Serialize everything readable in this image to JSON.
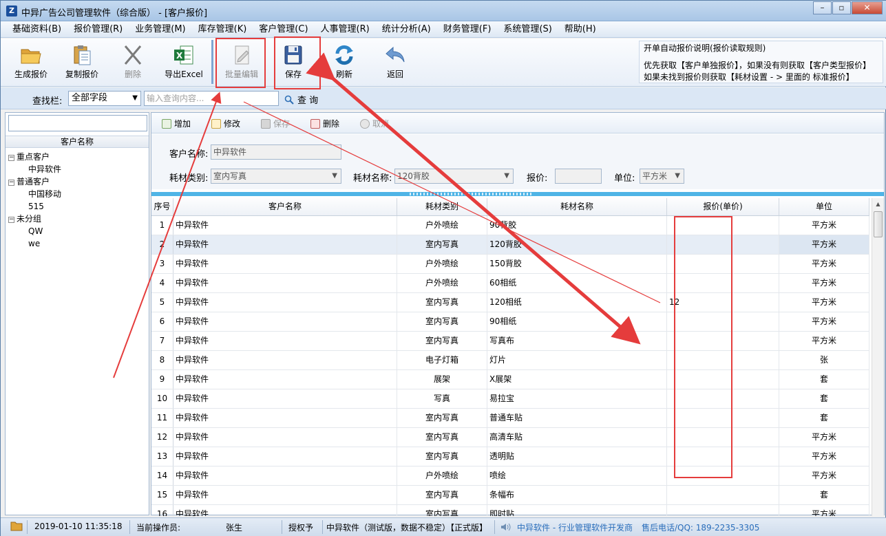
{
  "window": {
    "title": "中异广告公司管理软件（综合版） - [客户报价]",
    "controls": [
      "minimize-icon",
      "maximize-icon",
      "close-icon"
    ]
  },
  "menu": [
    "基础资料(B)",
    "报价管理(R)",
    "业务管理(M)",
    "库存管理(K)",
    "客户管理(C)",
    "人事管理(R)",
    "统计分析(A)",
    "财务管理(F)",
    "系统管理(S)",
    "帮助(H)"
  ],
  "toolbar": {
    "generate": "生成报价",
    "copy": "复制报价",
    "delete": "删除",
    "export": "导出Excel",
    "batch_edit": "批量编辑",
    "save": "保存",
    "refresh": "刷新",
    "back": "返回"
  },
  "help": {
    "title": "开单自动报价说明(报价读取规则)",
    "line1": "优先获取【客户单独报价】，如果没有则获取【客户类型报价】",
    "line2": "如果未找到报价则获取【耗材设置 - > 里面的 标准报价】"
  },
  "search": {
    "label": "查找栏:",
    "field": "全部字段",
    "placeholder": "输入查询内容...",
    "button": "查 询"
  },
  "tree": {
    "header": "客户名称",
    "groups": [
      {
        "label": "重点客户",
        "toggle": "−",
        "children": [
          "中异软件"
        ]
      },
      {
        "label": "普通客户",
        "toggle": "−",
        "children": [
          "中国移动",
          "515"
        ]
      },
      {
        "label": "未分组",
        "toggle": "−",
        "children": [
          "QW",
          "we"
        ]
      }
    ]
  },
  "sub_toolbar": {
    "add": "增加",
    "edit": "修改",
    "save": "保存",
    "delete": "删除",
    "cancel": "取消"
  },
  "form": {
    "customer_label": "客户名称:",
    "customer_value": "中异软件",
    "category_label": "耗材类别:",
    "category_value": "室内写真",
    "material_label": "耗材名称:",
    "material_value": "120背胶",
    "price_label": "报价:",
    "price_value": "",
    "unit_label": "单位:",
    "unit_value": "平方米"
  },
  "grid": {
    "headers": [
      "序号",
      "客户名称",
      "耗材类别",
      "耗材名称",
      "报价(单价)",
      "单位"
    ],
    "selected_row": 2,
    "rows": [
      [
        "1",
        "中异软件",
        "户外喷绘",
        "90背胶",
        "",
        "平方米"
      ],
      [
        "2",
        "中异软件",
        "室内写真",
        "120背胶",
        "",
        "平方米"
      ],
      [
        "3",
        "中异软件",
        "户外喷绘",
        "150背胶",
        "",
        "平方米"
      ],
      [
        "4",
        "中异软件",
        "户外喷绘",
        "60相纸",
        "",
        "平方米"
      ],
      [
        "5",
        "中异软件",
        "室内写真",
        "120相纸",
        "12",
        "平方米"
      ],
      [
        "6",
        "中异软件",
        "室内写真",
        "90相纸",
        "",
        "平方米"
      ],
      [
        "7",
        "中异软件",
        "室内写真",
        "写真布",
        "",
        "平方米"
      ],
      [
        "8",
        "中异软件",
        "电子灯箱",
        "灯片",
        "",
        "张"
      ],
      [
        "9",
        "中异软件",
        "展架",
        "X展架",
        "",
        "套"
      ],
      [
        "10",
        "中异软件",
        "写真",
        "易拉宝",
        "",
        "套"
      ],
      [
        "11",
        "中异软件",
        "室内写真",
        "普通车贴",
        "",
        "套"
      ],
      [
        "12",
        "中异软件",
        "室内写真",
        "高清车贴",
        "",
        "平方米"
      ],
      [
        "13",
        "中异软件",
        "室内写真",
        "透明贴",
        "",
        "平方米"
      ],
      [
        "14",
        "中异软件",
        "户外喷绘",
        "喷绘",
        "",
        "平方米"
      ],
      [
        "15",
        "中异软件",
        "室内写真",
        "条幅布",
        "",
        "套"
      ],
      [
        "16",
        "中异软件",
        "室内写真",
        "即时贴",
        "",
        "平方米"
      ]
    ]
  },
  "status": {
    "datetime": "2019-01-10 11:35:18",
    "operator_label": "当前操作员:",
    "operator": "张生",
    "auth": "授权予",
    "license": "中异软件（测试版，数据不稳定）【正式版】",
    "vendor": "中异软件 - 行业管理软件开发商",
    "support": "售后电话/QQ: 189-2235-3305"
  },
  "colors": {
    "annotation": "#e53c3c",
    "splitter": "#4fb4e6",
    "accent_blue": "#2a6ebb"
  }
}
